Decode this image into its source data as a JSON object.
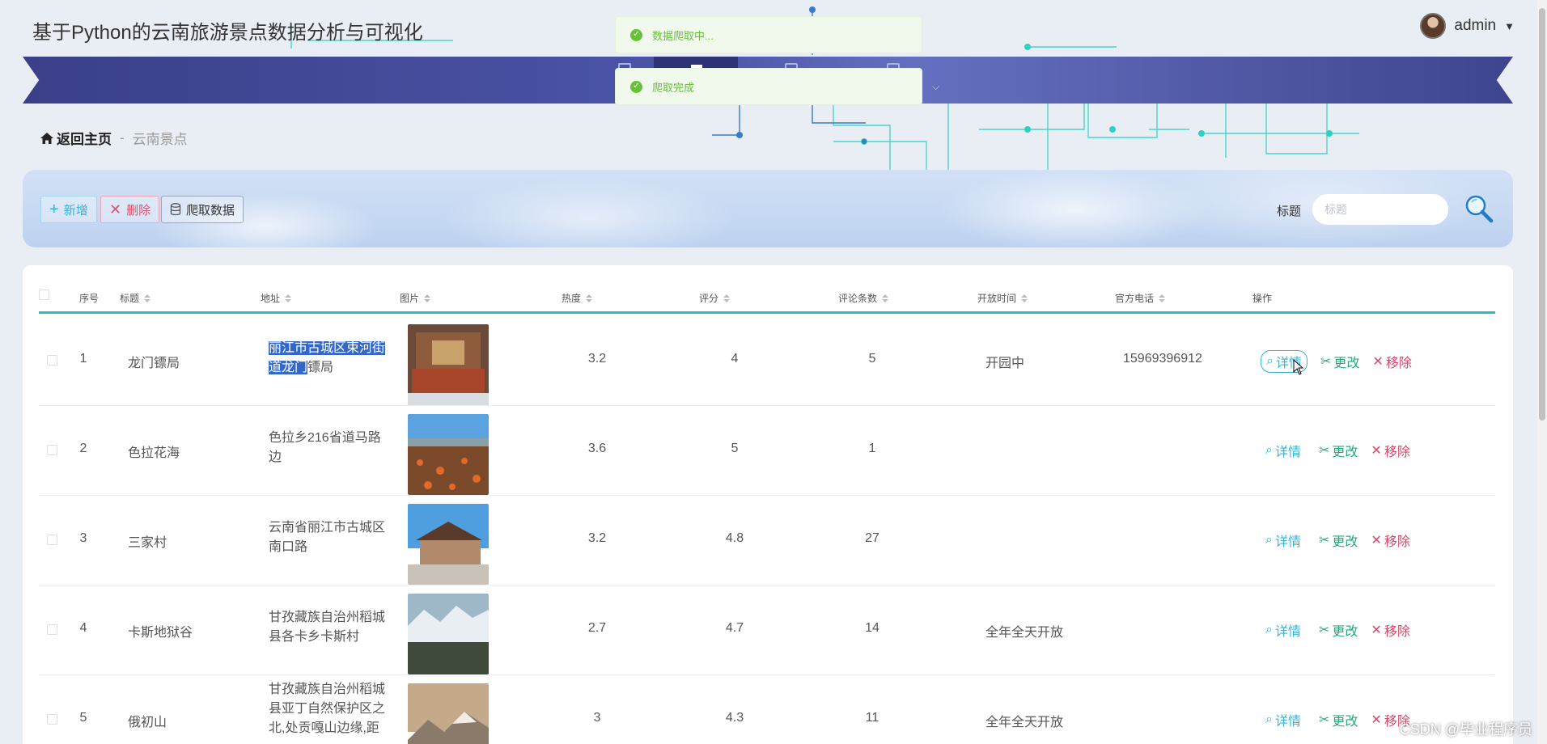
{
  "app": {
    "title": "基于Python的云南旅游景点数据分析与可视化"
  },
  "user": {
    "name": "admin"
  },
  "toasts": [
    {
      "text": "数据爬取中..."
    },
    {
      "text": "爬取完成"
    }
  ],
  "breadcrumb": {
    "home": "返回主页",
    "separator": "-",
    "current": "云南景点"
  },
  "toolbar": {
    "add_label": "新增",
    "delete_label": "删除",
    "crawl_label": "爬取数据",
    "search_label": "标题",
    "search_placeholder": "标题"
  },
  "table": {
    "headers": [
      "序号",
      "标题",
      "地址",
      "图片",
      "热度",
      "评分",
      "评论条数",
      "开放时间",
      "官方电话",
      "操作"
    ],
    "op_labels": {
      "detail": "详情",
      "edit": "更改",
      "remove": "移除"
    },
    "rows": [
      {
        "idx": "1",
        "title": "龙门镖局",
        "addr_sel": "丽江市古城区束河街道龙门",
        "addr_rest": "镖局",
        "hot": "3.2",
        "score": "4",
        "comments": "5",
        "open": "开园中",
        "phone": "15969396912"
      },
      {
        "idx": "2",
        "title": "色拉花海",
        "addr_sel": "",
        "addr_rest": "色拉乡216省道马路边",
        "hot": "3.6",
        "score": "5",
        "comments": "1",
        "open": "",
        "phone": ""
      },
      {
        "idx": "3",
        "title": "三家村",
        "addr_sel": "",
        "addr_rest": "云南省丽江市古城区南口路",
        "hot": "3.2",
        "score": "4.8",
        "comments": "27",
        "open": "",
        "phone": ""
      },
      {
        "idx": "4",
        "title": "卡斯地狱谷",
        "addr_sel": "",
        "addr_rest": "甘孜藏族自治州稻城县各卡乡卡斯村",
        "hot": "2.7",
        "score": "4.7",
        "comments": "14",
        "open": "全年全天开放",
        "phone": ""
      },
      {
        "idx": "5",
        "title": "俄初山",
        "addr_sel": "",
        "addr_rest": "甘孜藏族自治州稻城县亚丁自然保护区之北,处贡嘎山边缘,距",
        "hot": "3",
        "score": "4.3",
        "comments": "11",
        "open": "全年全天开放",
        "phone": ""
      }
    ]
  },
  "watermark": "CSDN @毕业程序员",
  "colors": {
    "accent": "#2fb8d0",
    "nav": "#3b3f88",
    "success": "#67c23a",
    "danger": "#d9486a"
  }
}
